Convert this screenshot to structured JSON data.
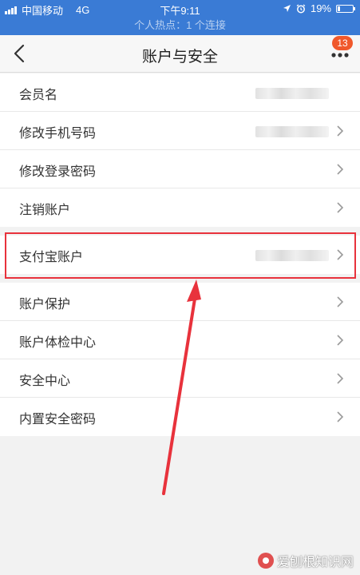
{
  "status_bar": {
    "carrier": "中国移动",
    "network": "4G",
    "time": "下午9:11",
    "battery": "19%",
    "battery_level": 0.19
  },
  "hotspot_banner": "个人热点：1 个连接",
  "nav": {
    "title": "账户与安全",
    "badge": "13"
  },
  "groups": [
    {
      "items": [
        {
          "label": "会员名",
          "has_value": true,
          "has_chevron": false
        },
        {
          "label": "修改手机号码",
          "has_value": true,
          "has_chevron": true
        },
        {
          "label": "修改登录密码",
          "has_value": false,
          "has_chevron": true
        },
        {
          "label": "注销账户",
          "has_value": false,
          "has_chevron": true
        }
      ]
    },
    {
      "items": [
        {
          "label": "支付宝账户",
          "has_value": true,
          "has_chevron": true
        }
      ]
    },
    {
      "items": [
        {
          "label": "账户保护",
          "has_value": false,
          "has_chevron": true
        },
        {
          "label": "账户体检中心",
          "has_value": false,
          "has_chevron": true
        },
        {
          "label": "安全中心",
          "has_value": false,
          "has_chevron": true
        },
        {
          "label": "内置安全密码",
          "has_value": false,
          "has_chevron": true
        }
      ]
    }
  ],
  "watermark": "爱刨根知识网",
  "colors": {
    "status_bar": "#3a7bd5",
    "badge": "#f0582b",
    "highlight": "#e8323c"
  }
}
